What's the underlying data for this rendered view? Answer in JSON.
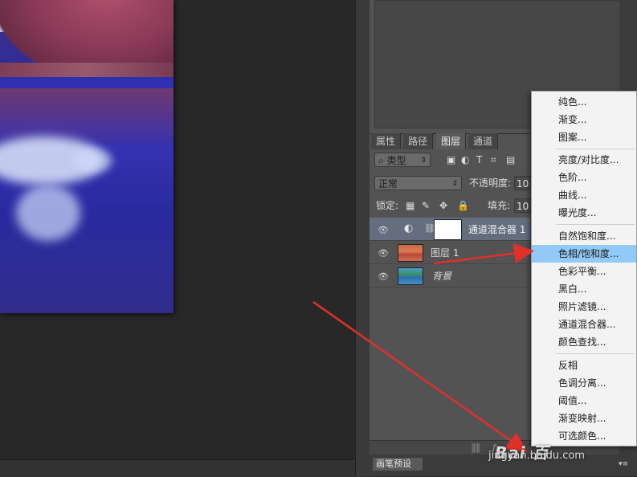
{
  "tabs": [
    "属性",
    "路径",
    "图层",
    "通道"
  ],
  "filter": {
    "kind_label": "类型"
  },
  "blend": {
    "mode": "正常",
    "opacity_label": "不透明度:",
    "opacity_value": "10"
  },
  "lock": {
    "label": "锁定:",
    "fill_label": "填充:",
    "fill_value": "10"
  },
  "layers": [
    {
      "name": "通道混合器 1",
      "selected": true
    },
    {
      "name": "图层 1",
      "selected": false
    },
    {
      "name": "背景",
      "selected": false
    }
  ],
  "brush_panel": {
    "tab": "画笔预设"
  },
  "footer_icons": [
    "link-icon",
    "fx-icon"
  ],
  "menu": {
    "groups": [
      [
        "纯色...",
        "渐变...",
        "图案..."
      ],
      [
        "亮度/对比度...",
        "色阶...",
        "曲线...",
        "曝光度..."
      ],
      [
        "自然饱和度...",
        "色相/饱和度...",
        "色彩平衡...",
        "黑白...",
        "照片滤镜...",
        "通道混合器...",
        "颜色查找..."
      ],
      [
        "反相",
        "色调分离...",
        "阈值...",
        "渐变映射...",
        "可选颜色..."
      ]
    ],
    "highlighted": "色相/饱和度..."
  },
  "watermark": {
    "logo": "Bai 百",
    "url": "jingyan.baidu.com"
  },
  "colors": {
    "menu_highlight": "#91c9f7",
    "arrow": "#e0302a",
    "selected_row": "#646e7e"
  }
}
